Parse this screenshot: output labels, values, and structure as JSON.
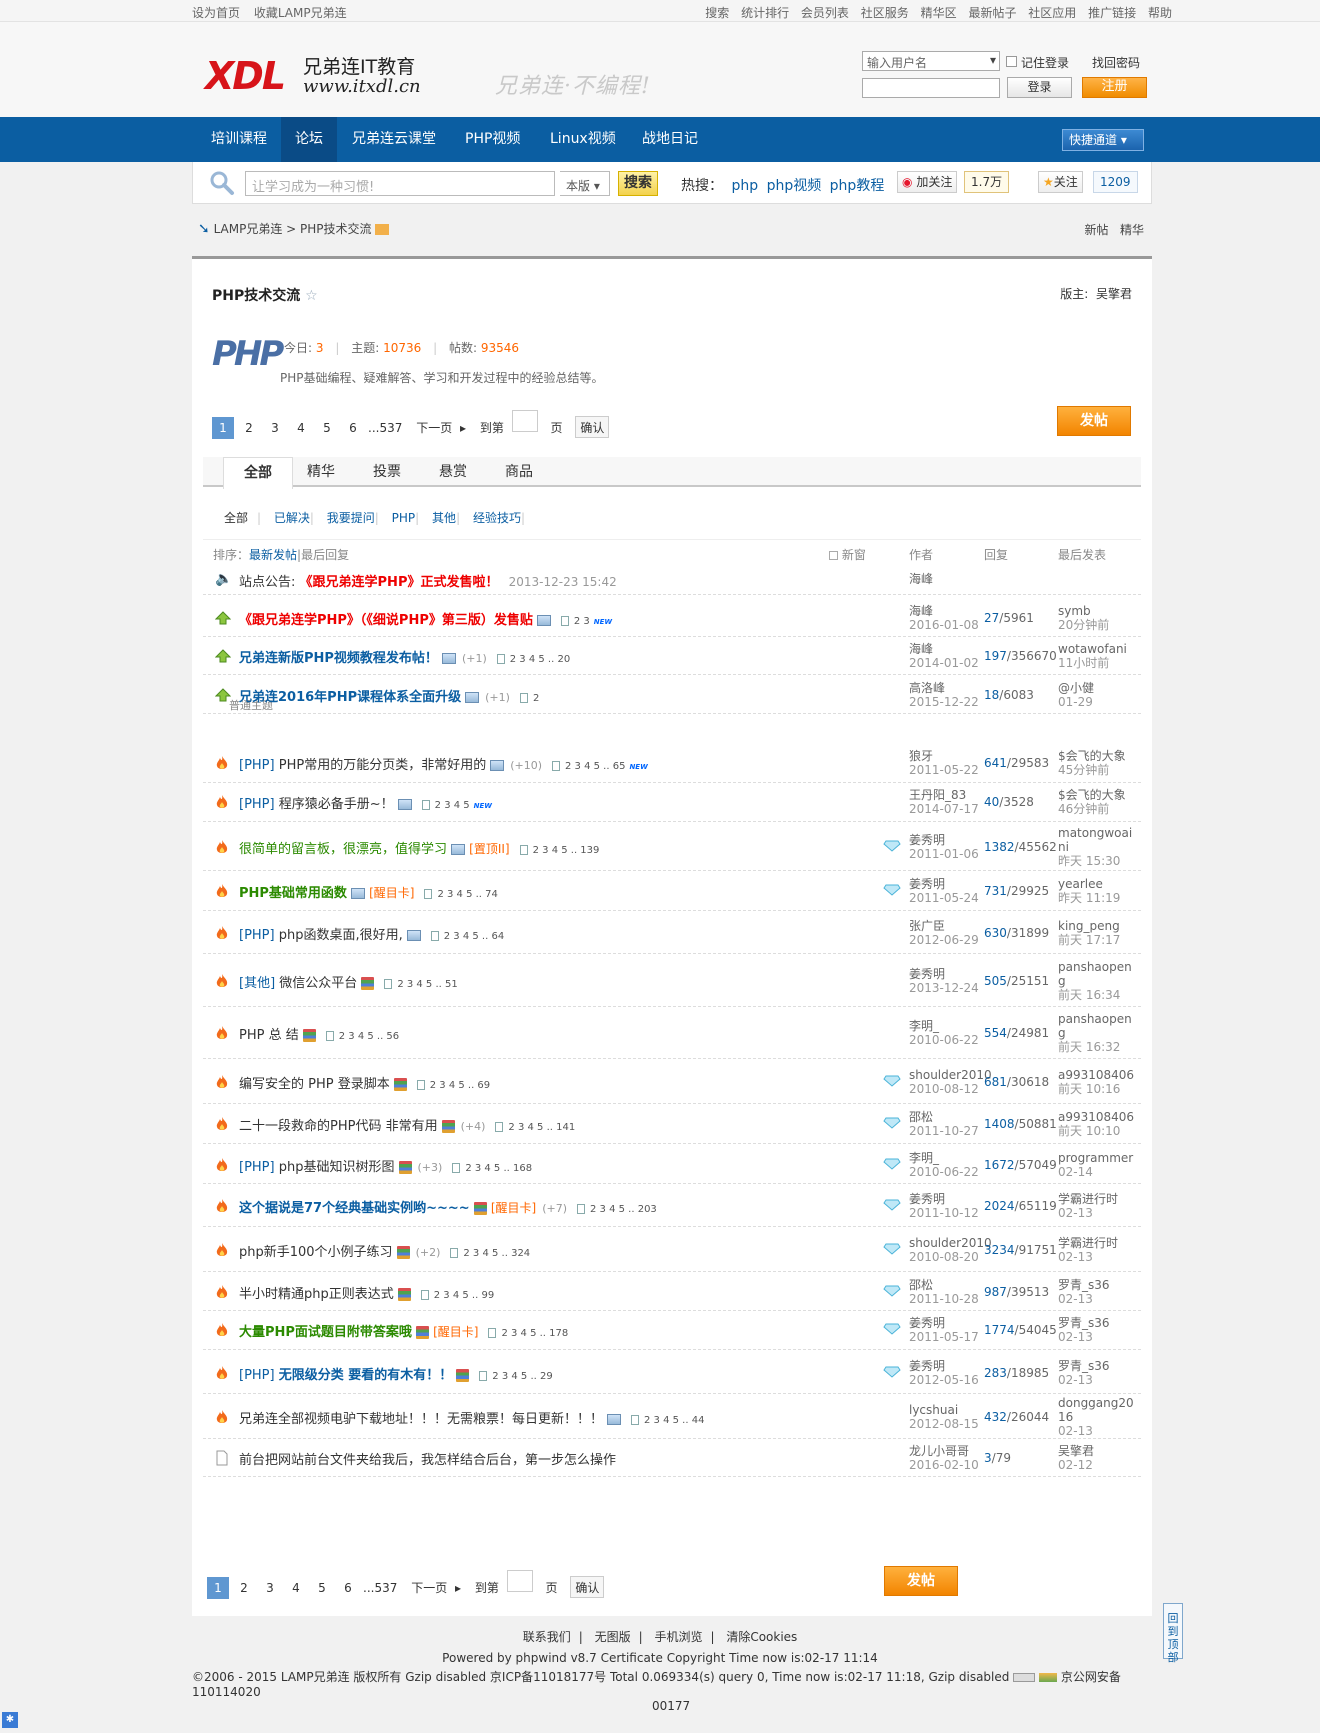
{
  "topbar": {
    "left": [
      "设为首页",
      "收藏LAMP兄弟连"
    ],
    "right": [
      "搜索",
      "统计排行",
      "会员列表",
      "社区服务",
      "精华区",
      "最新帖子",
      "社区应用",
      "推广链接",
      "帮助"
    ]
  },
  "header": {
    "logo_mark": "XDL",
    "logo_cn": "兄弟连IT教育",
    "logo_url": "www.itxdl.cn",
    "slogan": "兄弟连·不编程!",
    "login": {
      "username_select": "输入用户名",
      "remember": "记住登录",
      "find_password": "找回密码",
      "login_button": "登录",
      "register_button": "注册"
    }
  },
  "nav": {
    "items": [
      "培训课程",
      "论坛",
      "兄弟连云课堂",
      "PHP视频",
      "Linux视频",
      "战地日记"
    ],
    "active": "论坛",
    "quick": "快捷通道"
  },
  "search": {
    "placeholder": "让学习成为一种习惯!",
    "scope": "本版",
    "button": "搜索",
    "hot_label": "热搜：",
    "hot": [
      "php",
      "php视频",
      "php教程"
    ],
    "weibo_follow": "加关注",
    "weibo_count": "1.7万",
    "follow": "关注",
    "follow_count": "1209"
  },
  "breadcrumb": {
    "home": "LAMP兄弟连",
    "sep": ">",
    "current": "PHP技术交流",
    "right": [
      "新帖",
      "精华"
    ]
  },
  "forum": {
    "title": "PHP技术交流",
    "moderator_label": "版主:",
    "moderator": "吴擎君",
    "today_label": "今日:",
    "today": "3",
    "topics_label": "主题:",
    "topics": "10736",
    "posts_label": "帖数:",
    "posts": "93546",
    "description": "PHP基础编程、疑难解答、学习和开发过程中的经验总结等。",
    "logo_text": "PHP"
  },
  "pager": {
    "pages": [
      "1",
      "2",
      "3",
      "4",
      "5",
      "6",
      "...537"
    ],
    "next": "下一页",
    "goto": "到第",
    "page_unit": "页",
    "confirm": "确认",
    "post_button": "发帖"
  },
  "tabs": [
    "全部",
    "精华",
    "投票",
    "悬赏",
    "商品"
  ],
  "subtypes": [
    "全部",
    "已解决",
    "我要提问",
    "PHP",
    "其他",
    "经验技巧"
  ],
  "thead": {
    "sort_label": "排序：",
    "sort_new": "最新发帖",
    "sort_reply": "最后回复",
    "new_window": "新窗",
    "author": "作者",
    "reply": "回复",
    "last": "最后发表"
  },
  "announcement": {
    "label": "站点公告:",
    "title": "《跟兄弟连学PHP》正式发售啦！",
    "date": "2013-12-23 15:42",
    "author": "海峰"
  },
  "normal_label": "普通主题",
  "threads": [
    {
      "title": "《跟兄弟连学PHP》（《细说PHP》第三版）发售贴",
      "author": "海峰",
      "date": "2016-01-08",
      "replies": "27",
      "views": "5961",
      "last_user": "symb",
      "last_time": "20分钟前"
    },
    {
      "title": "兄弟连新版PHP视频教程发布帖！",
      "plus": "(+1)",
      "pages": "2 3 4 5 .. 20",
      "author": "海峰",
      "date": "2014-01-02",
      "replies": "197",
      "views": "356670",
      "last_user": "wotawofani",
      "last_time": "11小时前"
    },
    {
      "title": "兄弟连2016年PHP课程体系全面升级",
      "plus": "(+1)",
      "pages": "2",
      "author": "高洛峰",
      "date": "2015-12-22",
      "replies": "18",
      "views": "6083",
      "last_user": "@小健",
      "last_time": "01-29"
    },
    {
      "type": "[PHP]",
      "title": "PHP常用的万能分页类，非常好用的",
      "plus": "(+10)",
      "pages": "2 3 4 5 .. 65",
      "author": "狼牙",
      "date": "2011-05-22",
      "replies": "641",
      "views": "29583",
      "last_user": "$会飞的大象",
      "last_time": "45分钟前"
    },
    {
      "type": "[PHP]",
      "title": "程序猿必备手册~！",
      "pages": "2 3 4 5",
      "author": "王丹阳_83",
      "date": "2014-07-17",
      "replies": "40",
      "views": "3528",
      "last_user": "$会飞的大象",
      "last_time": "46分钟前"
    },
    {
      "title": "很简单的留言板，很漂亮，值得学习",
      "tag": "[置顶II]",
      "pages": "2 3 4 5 .. 139",
      "author": "姜秀明",
      "date": "2011-01-06",
      "replies": "1382",
      "views": "45562",
      "last_user": "matongwoaini",
      "last_time": "昨天 15:30"
    },
    {
      "title": "PHP基础常用函数",
      "tag": "[醒目卡]",
      "pages": "2 3 4 5 .. 74",
      "author": "姜秀明",
      "date": "2011-05-24",
      "replies": "731",
      "views": "29925",
      "last_user": "yearlee",
      "last_time": "昨天 11:19"
    },
    {
      "type": "[PHP]",
      "title": "php函数桌面,很好用,",
      "pages": "2 3 4 5 .. 64",
      "author": "张广臣",
      "date": "2012-06-29",
      "replies": "630",
      "views": "31899",
      "last_user": "king_peng",
      "last_time": "前天 17:17"
    },
    {
      "type": "[其他]",
      "title": "微信公众平台",
      "pages": "2 3 4 5 .. 51",
      "author": "姜秀明",
      "date": "2013-12-24",
      "replies": "505",
      "views": "25151",
      "last_user": "panshaopeng",
      "last_time": "前天 16:34"
    },
    {
      "title": "PHP 总 结",
      "pages": "2 3 4 5 .. 56",
      "author": "李明_",
      "date": "2010-06-22",
      "replies": "554",
      "views": "24981",
      "last_user": "panshaopeng",
      "last_time": "前天 16:32"
    },
    {
      "title": "编写安全的 PHP 登录脚本",
      "pages": "2 3 4 5 .. 69",
      "author": "shoulder2010",
      "date": "2010-08-12",
      "replies": "681",
      "views": "30618",
      "last_user": "a993108406",
      "last_time": "前天 10:16"
    },
    {
      "title": "二十一段救命的PHP代码  非常有用",
      "plus": "(+4)",
      "pages": "2 3 4 5 .. 141",
      "author": "邵松",
      "date": "2011-10-27",
      "replies": "1408",
      "views": "50881",
      "last_user": "a993108406",
      "last_time": "前天 10:10"
    },
    {
      "type": "[PHP]",
      "title": "php基础知识树形图",
      "plus": "(+3)",
      "pages": "2 3 4 5 .. 168",
      "author": "李明_",
      "date": "2010-06-22",
      "replies": "1672",
      "views": "57049",
      "last_user": "programmer",
      "last_time": "02-14"
    },
    {
      "title": "这个据说是77个经典基础实例哟~~~~",
      "tag": "[醒目卡]",
      "plus": "(+7)",
      "pages": "2 3 4 5 .. 203",
      "author": "姜秀明",
      "date": "2011-10-12",
      "replies": "2024",
      "views": "65119",
      "last_user": "学霸进行时",
      "last_time": "02-13"
    },
    {
      "title": "php新手100个小例子练习",
      "plus": "(+2)",
      "pages": "2 3 4 5 .. 324",
      "author": "shoulder2010",
      "date": "2010-08-20",
      "replies": "3234",
      "views": "91751",
      "last_user": "学霸进行时",
      "last_time": "02-13"
    },
    {
      "title": "半小时精通php正则表达式",
      "pages": "2 3 4 5 .. 99",
      "author": "邵松",
      "date": "2011-10-28",
      "replies": "987",
      "views": "39513",
      "last_user": "罗青_s36",
      "last_time": "02-13"
    },
    {
      "title": "大量PHP面试题目附带答案哦",
      "tag": "[醒目卡]",
      "pages": "2 3 4 5 .. 178",
      "author": "姜秀明",
      "date": "2011-05-17",
      "replies": "1774",
      "views": "54045",
      "last_user": "罗青_s36",
      "last_time": "02-13"
    },
    {
      "type": "[PHP]",
      "title": "无限级分类  要看的有木有！！",
      "pages": "2 3 4 5 .. 29",
      "author": "姜秀明",
      "date": "2012-05-16",
      "replies": "283",
      "views": "18985",
      "last_user": "罗青_s36",
      "last_time": "02-13"
    },
    {
      "title": "兄弟连全部视频电驴下载地址！！！无需粮票！每日更新！！！",
      "pages": "2 3 4 5 .. 44",
      "author": "lycshuai",
      "date": "2012-08-15",
      "replies": "432",
      "views": "26044",
      "last_user": "donggang2016",
      "last_time": "02-13"
    },
    {
      "title": "前台把网站前台文件夹给我后，我怎样结合后台，第一步怎么操作",
      "author": "龙儿小哥哥",
      "date": "2016-02-10",
      "replies": "3",
      "views": "79",
      "last_user": "吴擎君",
      "last_time": "02-12"
    }
  ],
  "first_thread_pages": "2 3",
  "footer": {
    "links": [
      "联系我们",
      "无图版",
      "手机浏览",
      "清除Cookies"
    ],
    "powered": "Powered by phpwind v8.7 Certificate Copyright Time now is:02-17 11:14",
    "copyright": "©2006 - 2015 LAMP兄弟连 版权所有 Gzip disabled 京ICP备11018177号 Total 0.069334(s) query 0, Time now is:02-17 11:18, Gzip disabled",
    "police": "京公网安备110114020",
    "police2": "00177"
  },
  "backtop": "回到顶部",
  "colors": {
    "nav": "#0b5ea2",
    "accent": "#f08c00",
    "link": "#0b5ea2",
    "title_red": "#e00000",
    "title_green": "#2b8a00",
    "title_blue": "#0033cc"
  }
}
